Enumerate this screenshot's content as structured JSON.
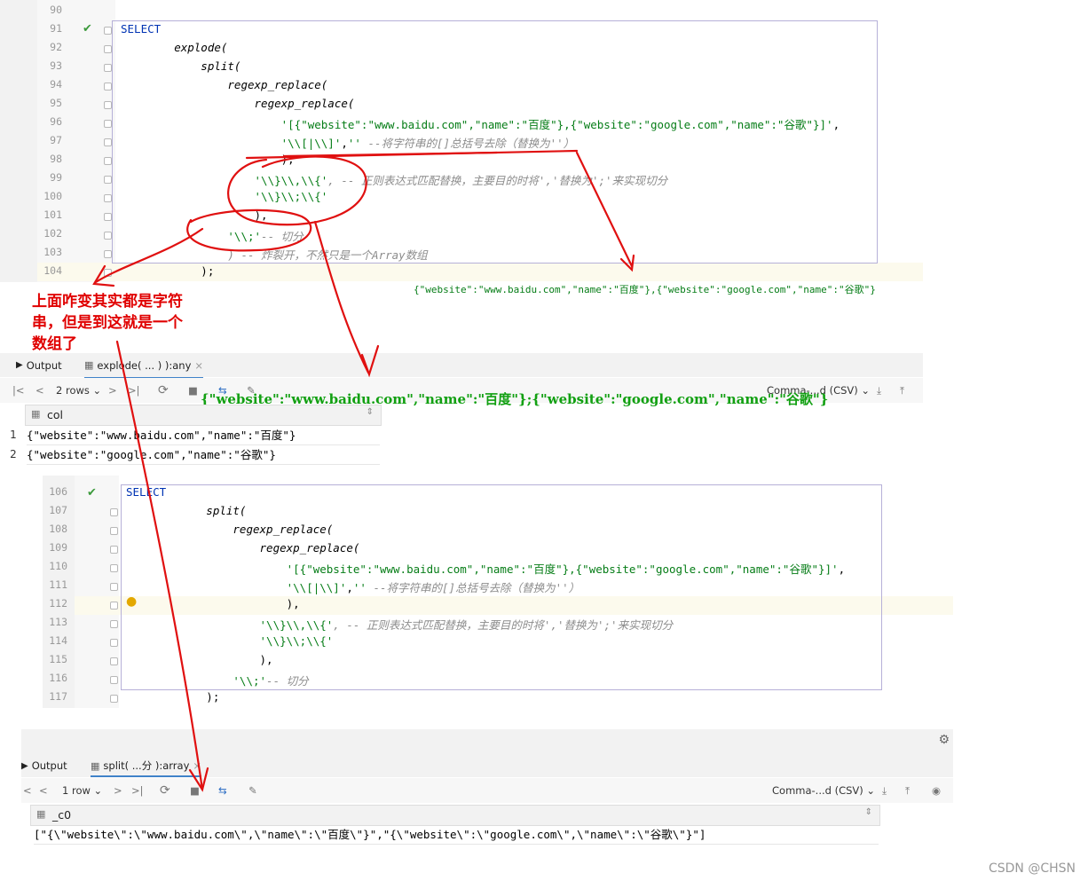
{
  "editor1": {
    "line_numbers": [
      "90",
      "91",
      "92",
      "93",
      "94",
      "95",
      "96",
      "97",
      "98",
      "99",
      "100",
      "101",
      "102",
      "103",
      "104"
    ],
    "lines": [
      {
        "parts": []
      },
      {
        "parts": [
          {
            "t": "SELECT",
            "c": "kw"
          }
        ]
      },
      {
        "parts": [
          {
            "t": "        explode(",
            "c": "fn"
          }
        ]
      },
      {
        "parts": [
          {
            "t": "            split(",
            "c": "fn"
          }
        ]
      },
      {
        "parts": [
          {
            "t": "                regexp_replace(",
            "c": "fn"
          }
        ]
      },
      {
        "parts": [
          {
            "t": "                    regexp_replace(",
            "c": "fn"
          }
        ]
      },
      {
        "parts": [
          {
            "t": "                        '[{\"website\":\"www.baidu.com\",\"name\":\"百度\"},{\"website\":\"google.com\",\"name\":\"谷歌\"}]'",
            "c": "str"
          },
          {
            "t": ",",
            "c": ""
          }
        ]
      },
      {
        "parts": [
          {
            "t": "                        '\\\\[|\\\\]'",
            "c": "str"
          },
          {
            "t": ",",
            "c": ""
          },
          {
            "t": "''",
            "c": "str"
          },
          {
            "t": " --将字符串的[]总括号去除（替换为''）",
            "c": "cm"
          }
        ]
      },
      {
        "parts": [
          {
            "t": "                        ),",
            "c": ""
          }
        ]
      },
      {
        "parts": [
          {
            "t": "                    '\\\\}\\\\,\\\\{'",
            "c": "str"
          },
          {
            "t": ", -- 正则表达式匹配替换，主要目的时将','替换为';'来实现切分",
            "c": "cm"
          }
        ]
      },
      {
        "parts": [
          {
            "t": "                    '\\\\}\\\\;\\\\{'",
            "c": "str"
          }
        ]
      },
      {
        "parts": [
          {
            "t": "                    ),",
            "c": ""
          }
        ]
      },
      {
        "parts": [
          {
            "t": "                '\\\\;'",
            "c": "str"
          },
          {
            "t": "-- 切分",
            "c": "cm"
          }
        ]
      },
      {
        "parts": [
          {
            "t": "                ) -- 炸裂开，不然只是一个Array数组",
            "c": "cm"
          }
        ]
      },
      {
        "parts": [
          {
            "t": "            );",
            "c": ""
          }
        ]
      }
    ]
  },
  "result1_text": "{\"website\":\"www.baidu.com\",\"name\":\"百度\"},{\"website\":\"google.com\",\"name\":\"谷歌\"}",
  "annotation_note": "上面咋变其实都是字符串，但是到这就是一个数组了",
  "annotation_green": "{\"website\":\"www.baidu.com\",\"name\":\"百度\"};{\"website\":\"google.com\",\"name\":\"谷歌\"}",
  "panel1": {
    "tab_output": "Output",
    "tab_result": "explode(          ... )          ):any",
    "rows_label": "2 rows",
    "export_label": "Comma-...d (CSV)",
    "column_header": "col",
    "rows": [
      {
        "num": "1",
        "value": "{\"website\":\"www.baidu.com\",\"name\":\"百度\"}"
      },
      {
        "num": "2",
        "value": "{\"website\":\"google.com\",\"name\":\"谷歌\"}"
      }
    ]
  },
  "editor2": {
    "line_numbers": [
      "106",
      "107",
      "108",
      "109",
      "110",
      "111",
      "112",
      "113",
      "114",
      "115",
      "116",
      "117"
    ],
    "lines": [
      {
        "parts": [
          {
            "t": "SELECT",
            "c": "kw"
          }
        ]
      },
      {
        "parts": [
          {
            "t": "            split(",
            "c": "fn"
          }
        ]
      },
      {
        "parts": [
          {
            "t": "                regexp_replace(",
            "c": "fn"
          }
        ]
      },
      {
        "parts": [
          {
            "t": "                    regexp_replace(",
            "c": "fn"
          }
        ]
      },
      {
        "parts": [
          {
            "t": "                        '[{\"website\":\"www.baidu.com\",\"name\":\"百度\"},{\"website\":\"google.com\",\"name\":\"谷歌\"}]'",
            "c": "str"
          },
          {
            "t": ",",
            "c": ""
          }
        ]
      },
      {
        "parts": [
          {
            "t": "                        '\\\\[|\\\\]'",
            "c": "str"
          },
          {
            "t": ",",
            "c": ""
          },
          {
            "t": "''",
            "c": "str"
          },
          {
            "t": " --将字符串的[]总括号去除（替换为''）",
            "c": "cm"
          }
        ]
      },
      {
        "parts": [
          {
            "t": "                        ),",
            "c": ""
          }
        ]
      },
      {
        "parts": [
          {
            "t": "                    '\\\\}\\\\,\\\\{'",
            "c": "str"
          },
          {
            "t": ", -- 正则表达式匹配替换，主要目的时将','替换为';'来实现切分",
            "c": "cm"
          }
        ]
      },
      {
        "parts": [
          {
            "t": "                    '\\\\}\\\\;\\\\{'",
            "c": "str"
          }
        ]
      },
      {
        "parts": [
          {
            "t": "                    ),",
            "c": ""
          }
        ]
      },
      {
        "parts": [
          {
            "t": "                '\\\\;'",
            "c": "str"
          },
          {
            "t": "-- 切分",
            "c": "cm"
          }
        ]
      },
      {
        "parts": [
          {
            "t": "            );",
            "c": ""
          }
        ]
      }
    ]
  },
  "panel2": {
    "tab_output": "Output",
    "tab_result": "split(          ...分          ):array",
    "rows_label": "1 row",
    "export_label": "Comma-...d (CSV)",
    "column_header": "_c0",
    "rows": [
      {
        "value": "[\"{\\\"website\\\":\\\"www.baidu.com\\\",\\\"name\\\":\\\"百度\\\"}\",\"{\\\"website\\\":\\\"google.com\\\",\\\"name\\\":\\\"谷歌\\\"}\"]"
      }
    ]
  },
  "watermark": "CSDN @CHSN"
}
